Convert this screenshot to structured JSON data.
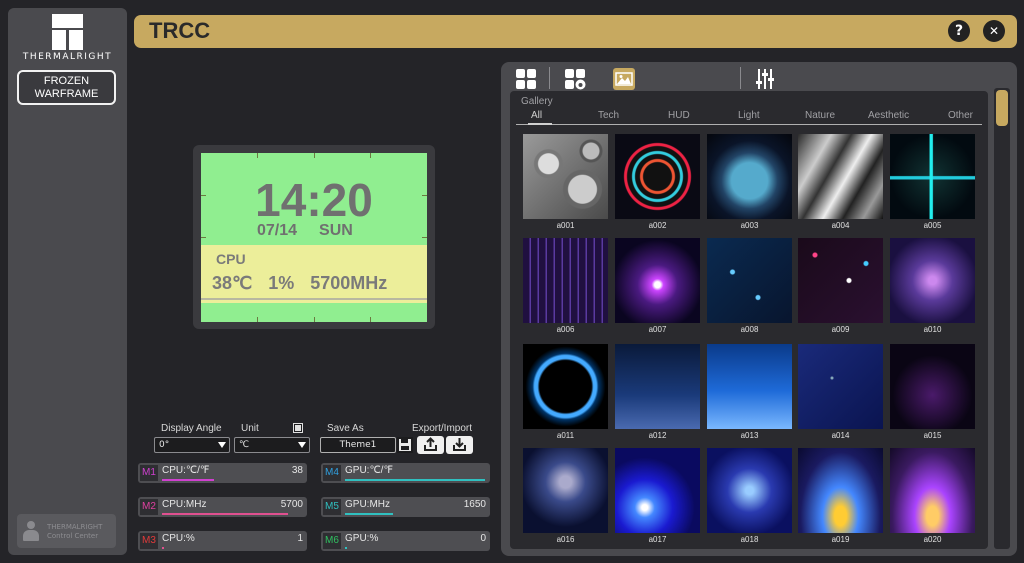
{
  "brand": {
    "name": "THERMALRIGHT"
  },
  "sidebar": {
    "theme_button": "FROZEN WARFRAME",
    "control_center": {
      "line1": "THERMALRIGHT",
      "line2": "Control Center"
    }
  },
  "titlebar": {
    "title": "TRCC",
    "help": "?",
    "close": "✕"
  },
  "preview": {
    "time": "14:20",
    "date": "07/14",
    "weekday": "SUN",
    "cpu_label": "CPU",
    "cpu_temp": "38℃",
    "cpu_usage": "1%",
    "cpu_freq": "5700MHz",
    "colors": {
      "screen_bg": "#90ee90",
      "band_bg": "#ecee9a",
      "text": "#707070"
    }
  },
  "controls": {
    "display_angle_label": "Display Angle",
    "display_angle_value": "0°",
    "unit_label": "Unit",
    "unit_value": "℃",
    "save_as_label": "Save As",
    "save_as_value": "Theme1",
    "export_import_label": "Export/Import"
  },
  "metrics": [
    {
      "tag": "M1",
      "label": "CPU:℃/℉",
      "value": "38",
      "tag_color": "#d040d0",
      "bar_color": "#d040d0",
      "level": 0.37
    },
    {
      "tag": "M2",
      "label": "CPU:MHz",
      "value": "5700",
      "tag_color": "#e040a0",
      "bar_color": "#e05090",
      "level": 0.9
    },
    {
      "tag": "M3",
      "label": "CPU:%",
      "value": "1",
      "tag_color": "#e03a3a",
      "bar_color": "#e05090",
      "level": 0.01
    },
    {
      "tag": "M4",
      "label": "GPU:℃/℉",
      "value": "",
      "tag_color": "#30a0e0",
      "bar_color": "#30c0c0",
      "level": 1.0
    },
    {
      "tag": "M5",
      "label": "GPU:MHz",
      "value": "1650",
      "tag_color": "#30c0c0",
      "bar_color": "#30c0c0",
      "level": 0.34
    },
    {
      "tag": "M6",
      "label": "GPU:%",
      "value": "0",
      "tag_color": "#30c060",
      "bar_color": "#30c0c0",
      "level": 0.0
    }
  ],
  "gallery": {
    "label": "Gallery",
    "categories": [
      "All",
      "Tech",
      "HUD",
      "Light",
      "Nature",
      "Aesthetic",
      "Other"
    ],
    "active_category": "All",
    "items": [
      "a001",
      "a002",
      "a003",
      "a004",
      "a005",
      "a006",
      "a007",
      "a008",
      "a009",
      "a010",
      "a011",
      "a012",
      "a013",
      "a014",
      "a015",
      "a016",
      "a017",
      "a018",
      "a019",
      "a020"
    ],
    "toolbar_icons": [
      "grid-icon",
      "grid-cloud-icon",
      "image-icon",
      "mixer-sliders-icon"
    ]
  },
  "accent_color": "#c7a960"
}
